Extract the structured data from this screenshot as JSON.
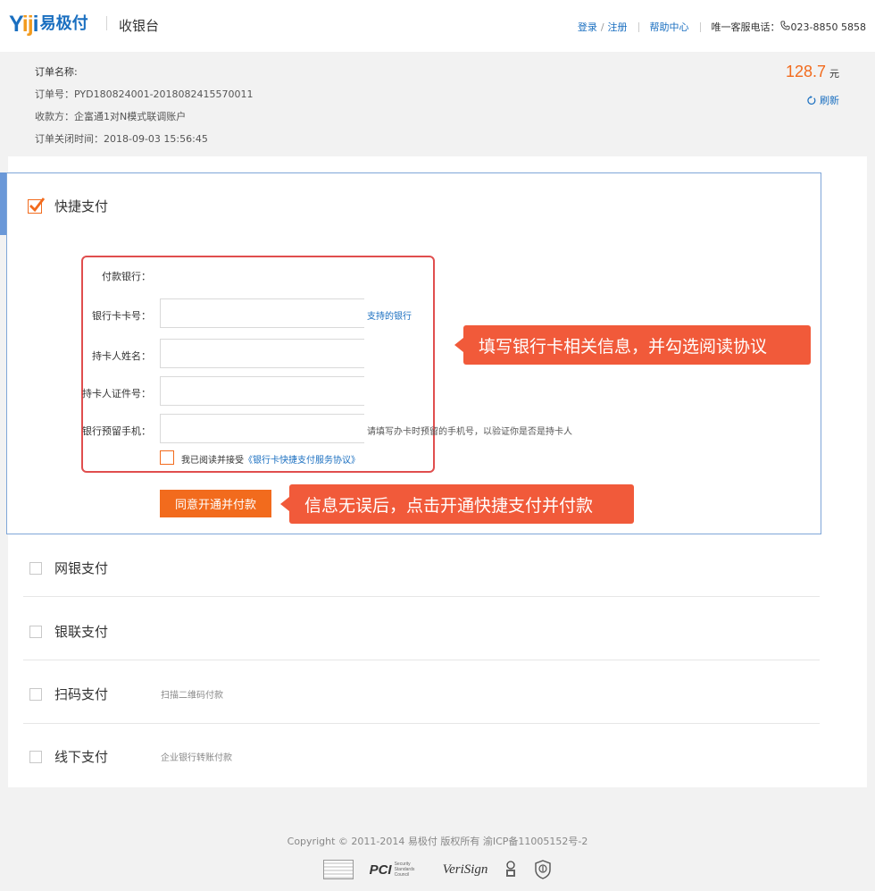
{
  "header": {
    "logo_latin": "Yiji",
    "logo_cn": "易极付",
    "section_title": "收银台",
    "login": "登录",
    "slash": "/",
    "register": "注册",
    "help": "帮助中心",
    "hotline_label": "唯一客服电话：",
    "hotline_number": "023-8850 5858"
  },
  "order": {
    "name_label": "订单名称:",
    "number": "订单号：PYD180824001-2018082415570011",
    "payee": "收款方：企富通1对N模式联调账户",
    "close_time": "订单关闭时间：2018-09-03 15:56:45",
    "amount": "128.7",
    "currency": "元",
    "refresh": "刷新"
  },
  "quick_pay": {
    "title": "快捷支付",
    "bank_label": "付款银行：",
    "card_label": "银行卡卡号：",
    "supported_banks": "支持的银行",
    "name_label": "持卡人姓名：",
    "id_label": "持卡人证件号：",
    "phone_label": "银行预留手机：",
    "phone_hint": "请填写办卡时预留的手机号，以验证你是否是持卡人",
    "agree_prefix": "我已阅读并接受",
    "agree_link": "《银行卡快捷支付服务协议》",
    "submit": "同意开通并付款",
    "callout_fill": "填写银行卡相关信息，并勾选阅读协议",
    "callout_submit": "信息无误后，点击开通快捷支付并付款"
  },
  "methods": [
    {
      "label": "网银支付",
      "desc": ""
    },
    {
      "label": "银联支付",
      "desc": ""
    },
    {
      "label": "扫码支付",
      "desc": "扫描二维码付款"
    },
    {
      "label": "线下支付",
      "desc": "企业银行转账付款"
    }
  ],
  "footer": {
    "copyright": "Copyright © 2011-2014 易极付 版权所有 渝ICP备11005152号-2",
    "pci_text": "PCI",
    "pci_sub": "Security Standards Council",
    "verisign": "VeriSign"
  },
  "colors": {
    "brand_blue": "#1a6fc0",
    "accent_orange": "#f26b1d",
    "callout_red": "#f15a3a",
    "frame_red": "#e04e4e"
  }
}
